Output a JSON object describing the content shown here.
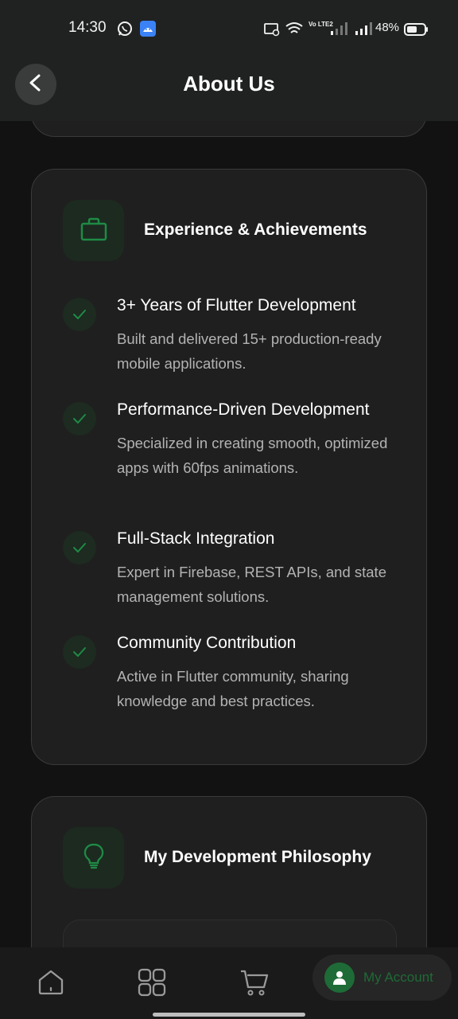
{
  "status_bar": {
    "time": "14:30",
    "battery": "48%",
    "network_label": "Vo LTE2"
  },
  "app_bar": {
    "title": "About Us",
    "back_icon": "chevron-left-icon"
  },
  "experience_card": {
    "title": "Experience & Achievements",
    "icon": "briefcase-icon",
    "items": [
      {
        "title": "3+ Years of Flutter Development",
        "description": "Built and delivered 15+ production-ready mobile applications."
      },
      {
        "title": "Performance-Driven Development",
        "description": "Specialized in creating smooth, optimized apps with 60fps animations."
      },
      {
        "title": "Full-Stack Integration",
        "description": "Expert in Firebase, REST APIs, and state management solutions."
      },
      {
        "title": "Community Contribution",
        "description": "Active in Flutter community, sharing knowledge and best practices."
      }
    ]
  },
  "philosophy_card": {
    "title": "My Development Philosophy",
    "icon": "lightbulb-icon"
  },
  "bottom_nav": {
    "account_label": "My Account",
    "items": [
      "home-icon",
      "grid-icon",
      "cart-icon",
      "account-icon"
    ]
  },
  "colors": {
    "accent": "#1e6b37",
    "background": "#121212",
    "card": "#1f1f1f",
    "appbar": "#202222"
  }
}
